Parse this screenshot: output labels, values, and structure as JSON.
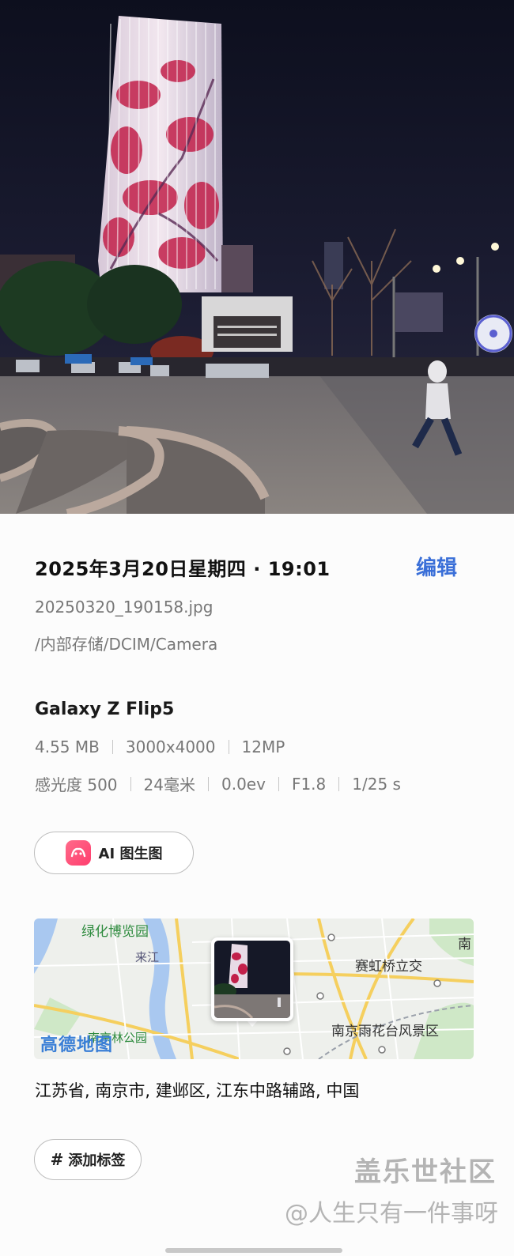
{
  "photo": {
    "description_icon": "night-street-photo"
  },
  "details": {
    "datetime": "2025年3月20日星期四 · 19:01",
    "edit_label": "编辑",
    "filename": "20250320_190158.jpg",
    "path": "/内部存储/DCIM/Camera",
    "model": "Galaxy Z Flip5",
    "specs_row1": [
      "4.55 MB",
      "3000x4000",
      "12MP"
    ],
    "specs_row2": [
      "感光度 500",
      "24毫米",
      "0.0ev",
      "F1.8",
      "1/25 s"
    ]
  },
  "ai_button": {
    "label": "AI 图生图"
  },
  "map": {
    "logo": "高德地图",
    "labels": {
      "park1": "绿化博览园",
      "river": "来江",
      "area1": "赛虹桥立交",
      "scenic": "南京雨花台风景区",
      "park2": "南京林公园",
      "edge": "南"
    }
  },
  "address": "江苏省, 南京市, 建邺区, 江东中路辅路, 中国",
  "tag_button": {
    "hash": "#",
    "label": "添加标签"
  },
  "watermark": {
    "line1": "盖乐世社区",
    "line2": "@人生只有一件事呀"
  },
  "colors": {
    "accent": "#3a6fd8",
    "ai_icon": "#ff3d6e"
  }
}
